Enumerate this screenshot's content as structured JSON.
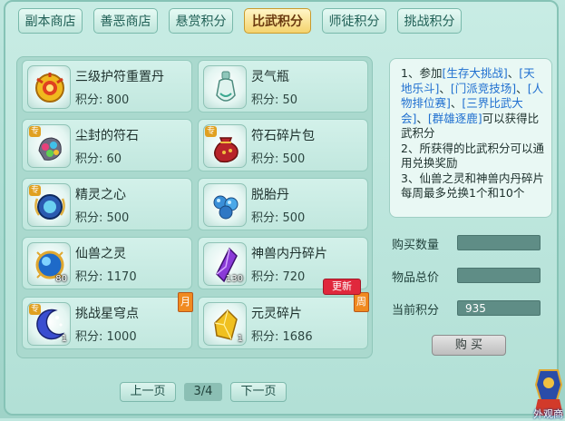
{
  "tabs": [
    {
      "label": "副本商店",
      "active": false
    },
    {
      "label": "善恶商店",
      "active": false
    },
    {
      "label": "悬赏积分",
      "active": false
    },
    {
      "label": "比武积分",
      "active": true
    },
    {
      "label": "师徒积分",
      "active": false
    },
    {
      "label": "挑战积分",
      "active": false
    }
  ],
  "items": [
    {
      "name": "三级护符重置丹",
      "points": "积分: 800",
      "icon": "gold-charm-icon"
    },
    {
      "name": "灵气瓶",
      "points": "积分: 50",
      "icon": "vase-icon"
    },
    {
      "name": "尘封的符石",
      "points": "积分: 60",
      "icon": "gem-stone-icon",
      "tag": "专"
    },
    {
      "name": "符石碎片包",
      "points": "积分: 500",
      "icon": "red-bag-icon",
      "tag": "专"
    },
    {
      "name": "精灵之心",
      "points": "积分: 500",
      "icon": "spirit-heart-icon",
      "tag": "专"
    },
    {
      "name": "脱胎丹",
      "points": "积分: 500",
      "icon": "blue-pills-icon"
    },
    {
      "name": "仙兽之灵",
      "points": "积分: 1170",
      "icon": "blue-orb-icon",
      "qty": "80"
    },
    {
      "name": "神兽内丹碎片",
      "points": "积分: 720",
      "icon": "purple-crystal-icon",
      "qty": "130"
    },
    {
      "name": "挑战星穹点",
      "points": "积分: 1000",
      "icon": "crescent-moon-icon",
      "qty": "1",
      "tag": "专",
      "ribbon": "月"
    },
    {
      "name": "元灵碎片",
      "points": "积分: 1686",
      "icon": "gold-shard-icon",
      "qty": "1",
      "ribbon": "周"
    }
  ],
  "new_badge": "更新",
  "info": {
    "line1_prefix": "1、参加",
    "line1_links": [
      "[生存大挑战]",
      "[天地乐斗]",
      "[门派竞技场]",
      "[人物排位赛]",
      "[三界比武大会]",
      "[群雄逐鹿]"
    ],
    "line1_suffix": "可以获得比武积分",
    "line2": "2、所获得的比武积分可以通用兑换奖励",
    "line3": "3、仙兽之灵和神兽内丹碎片每周最多兑换1个和10个"
  },
  "fields": {
    "quantity_label": "购买数量",
    "quantity_value": "",
    "total_label": "物品总价",
    "total_value": "",
    "current_label": "当前积分",
    "current_value": "935"
  },
  "buy_label": "购 买",
  "pager": {
    "prev": "上一页",
    "page": "3/4",
    "next": "下一页"
  },
  "corner_label": "外观商"
}
